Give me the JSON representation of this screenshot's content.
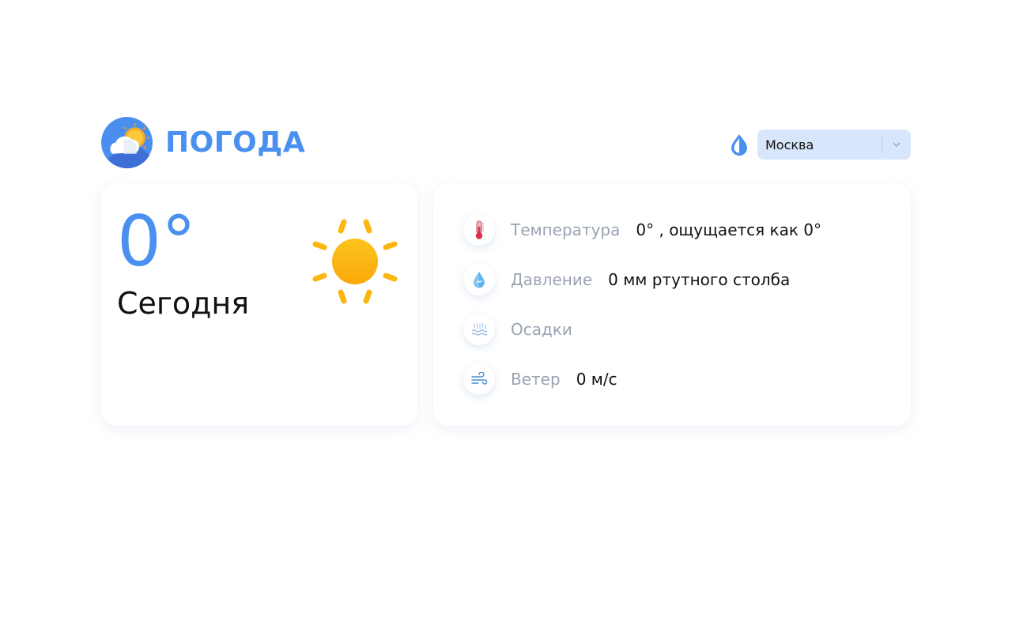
{
  "header": {
    "title": "ПОГОДА",
    "logo_icon": "cloud-sun-logo-icon",
    "theme_icon": "drop-icon"
  },
  "city_select": {
    "selected": "Москва",
    "chevron_icon": "chevron-down-icon"
  },
  "today": {
    "temperature": "0°",
    "label": "Сегодня",
    "weather_icon": "sun-icon"
  },
  "details": [
    {
      "icon": "thermometer-icon",
      "label": "Температура",
      "value": "0° , ощущается как 0°"
    },
    {
      "icon": "pressure-icon",
      "label": "Давление",
      "value": "0 мм ртутного столба"
    },
    {
      "icon": "precipitation-icon",
      "label": "Осадки",
      "value": ""
    },
    {
      "icon": "wind-icon",
      "label": "Ветер",
      "value": "0 м/с"
    }
  ],
  "colors": {
    "accent": "#4a90f0",
    "select_bg": "#d7e6fb",
    "sun": "#fbb70f",
    "label_gray": "#9aa3b2"
  }
}
